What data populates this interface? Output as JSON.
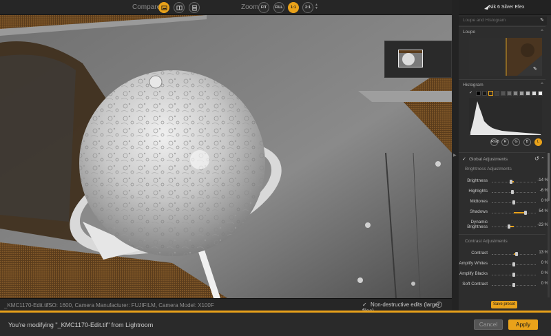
{
  "toolbar": {
    "compare_label": "Compare",
    "zoom_label": "Zoom",
    "zoom_fit": "FIT",
    "zoom_fill": "FILL",
    "zoom_1to1": "1:1",
    "zoom_2to1": "2:1",
    "icons": [
      "single-view-icon",
      "split-view-icon",
      "side-by-side-icon"
    ]
  },
  "product": {
    "name": "Nik 6 Silver Efex"
  },
  "panels": {
    "loupe_and_histogram": "Loupe and Histogram",
    "loupe": "Loupe",
    "histogram": "Histogram",
    "channels": [
      "RGB",
      "R",
      "G",
      "B",
      "L"
    ],
    "active_channel": "L"
  },
  "global": {
    "label": "Global Adjustments",
    "brightness_heading": "Brightness Adjustments",
    "contrast_heading": "Contrast Adjustments",
    "brightness": [
      {
        "label": "Brightness",
        "value": "-14 %",
        "num": -14
      },
      {
        "label": "Highlights",
        "value": "-6 %",
        "num": -6
      },
      {
        "label": "Midtones",
        "value": "0 %",
        "num": 0
      },
      {
        "label": "Shadows",
        "value": "54 %",
        "num": 54
      },
      {
        "label": "Dynamic Brightness",
        "line1": "Dynamic",
        "line2": "Brightness",
        "value": "-23 %",
        "num": -23
      }
    ],
    "contrast": [
      {
        "label": "Contrast",
        "value": "13 %",
        "num": 13
      },
      {
        "label": "Amplify Whites",
        "value": "0 %",
        "num": 0
      },
      {
        "label": "Amplify Blacks",
        "value": "0 %",
        "num": 0
      },
      {
        "label": "Soft Contrast",
        "value": "0 %",
        "num": 0
      }
    ]
  },
  "save_preset": "Save preset",
  "status": {
    "file": "_KMC1170-Edit.tif",
    "meta": "ISO: 1600, Camera Manufacturer: FUJIFILM, Camera Model: X100F",
    "nondestructive": "Non-destructive edits (larger files)"
  },
  "bottom": {
    "message": "You're modifying \"_KMC1170-Edit.tif\" from Lightroom",
    "cancel": "Cancel",
    "apply": "Apply"
  },
  "colors": {
    "accent": "#e9a21a",
    "panel": "#2d2d2d",
    "toolbar": "#262626"
  }
}
